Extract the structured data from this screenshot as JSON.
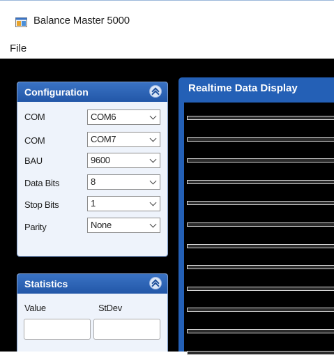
{
  "window": {
    "title": "Balance Master 5000",
    "icon": "app-window-icon"
  },
  "menu": {
    "file": "File"
  },
  "configuration": {
    "title": "Configuration",
    "rows": [
      {
        "label": "COM",
        "value": "COM6"
      },
      {
        "label": "COM",
        "value": "COM7"
      },
      {
        "label": "BAU",
        "value": "9600"
      },
      {
        "label": "Data Bits",
        "value": "8"
      },
      {
        "label": "Stop Bits",
        "value": "1"
      },
      {
        "label": "Parity",
        "value": "None"
      }
    ]
  },
  "statistics": {
    "title": "Statistics",
    "value_label": "Value",
    "stdev_label": "StDev",
    "value": "",
    "stdev": ""
  },
  "realtime": {
    "title": "Realtime Data Display"
  },
  "colors": {
    "panel_header": "#2257a8",
    "background": "#000000",
    "panel_body": "#eef3fb"
  }
}
